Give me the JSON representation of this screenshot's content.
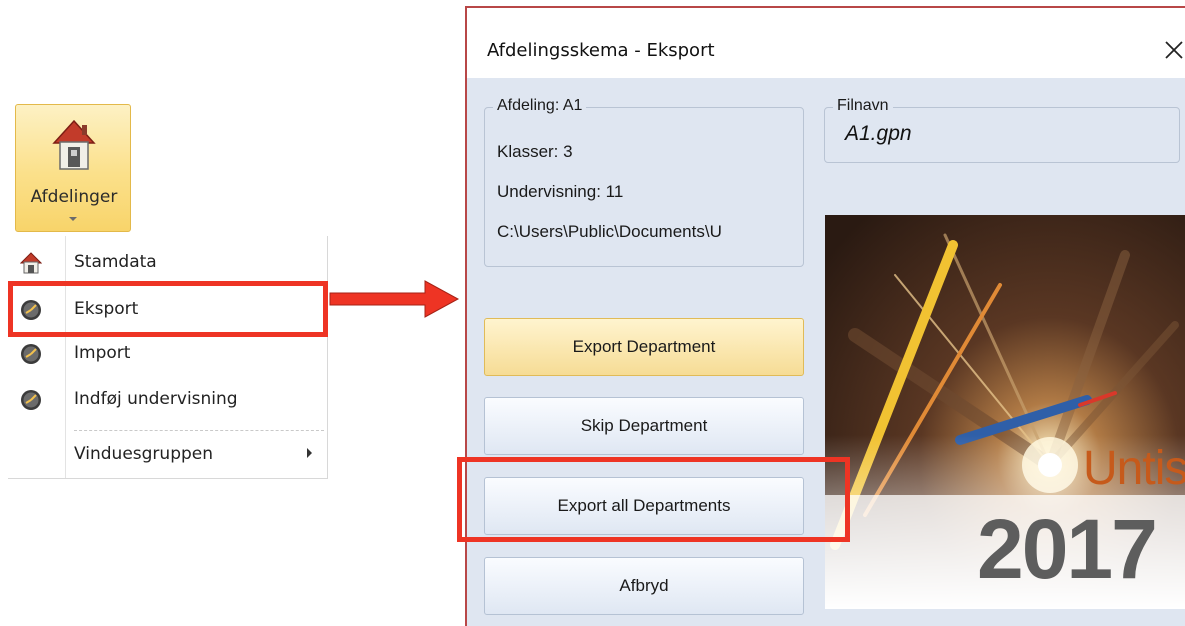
{
  "ribbon": {
    "label": "Afdelinger",
    "icon": "house-icon"
  },
  "menu": {
    "items": [
      {
        "label": "Stamdata",
        "icon": "house-icon"
      },
      {
        "label": "Eksport",
        "icon": "clock-icon"
      },
      {
        "label": "Import",
        "icon": "clock-icon"
      },
      {
        "label": "Indføj undervisning",
        "icon": "clock-icon"
      },
      {
        "label": "Vinduesgruppen",
        "icon": "submenu-arrow-icon"
      }
    ]
  },
  "dialog": {
    "title": "Afdelingsskema - Eksport",
    "department_group": {
      "legend": "Afdeling: A1",
      "classes": "Klasser: 3",
      "teaching": "Undervisning: 11",
      "path": "C:\\Users\\Public\\Documents\\U"
    },
    "file_group": {
      "legend": "Filnavn",
      "value": "A1.gpn"
    },
    "buttons": {
      "export_department": "Export Department",
      "skip_department": "Skip Department",
      "export_all": "Export all Departments",
      "cancel": "Afbryd"
    },
    "splash": {
      "brand": "Untis",
      "year": "2017"
    }
  },
  "colors": {
    "highlight": "#ee3424",
    "dialog_bg": "#dfe6f1",
    "primary_button": "#f6dc95",
    "brand": "#c65a1b"
  }
}
